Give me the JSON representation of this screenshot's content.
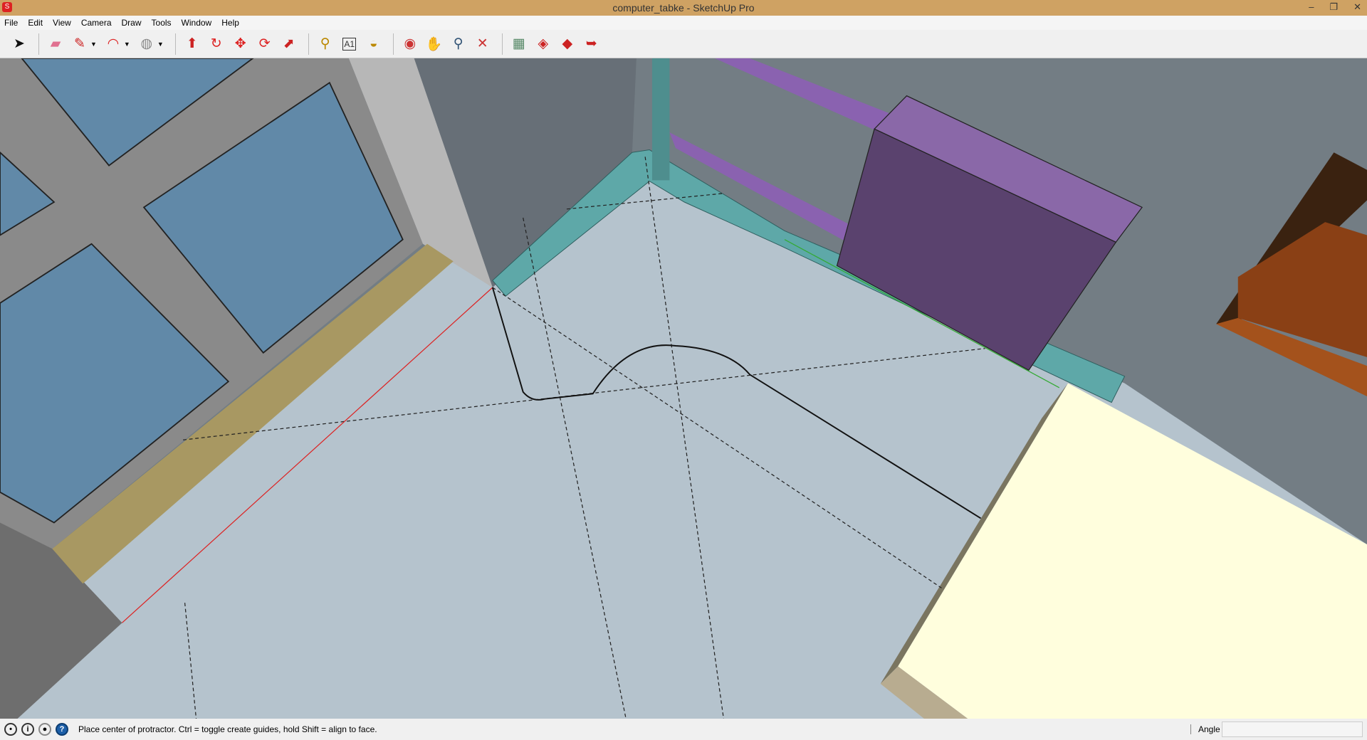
{
  "window": {
    "title": "computer_tabke - SketchUp Pro",
    "minimize": "–",
    "restore": "❐",
    "close": "✕"
  },
  "menu": [
    "File",
    "Edit",
    "View",
    "Camera",
    "Draw",
    "Tools",
    "Window",
    "Help"
  ],
  "toolbar": [
    {
      "name": "select-tool",
      "glyph": "➤",
      "color": "#111"
    },
    {
      "name": "eraser-tool",
      "glyph": "▰",
      "color": "#e07090"
    },
    {
      "name": "pencil-tool",
      "glyph": "✎",
      "color": "#c22",
      "dropdown": true
    },
    {
      "name": "arc-tool",
      "glyph": "◠",
      "color": "#d22",
      "dropdown": true
    },
    {
      "name": "circle-tool",
      "glyph": "◍",
      "color": "#888",
      "dropdown": true
    },
    {
      "name": "push-pull-tool",
      "glyph": "⬆",
      "color": "#c22"
    },
    {
      "name": "follow-me-tool",
      "glyph": "↻",
      "color": "#d22"
    },
    {
      "name": "move-tool",
      "glyph": "✥",
      "color": "#d22"
    },
    {
      "name": "rotate-tool",
      "glyph": "⟳",
      "color": "#d22"
    },
    {
      "name": "scale-tool",
      "glyph": "⬈",
      "color": "#c22"
    },
    {
      "name": "tape-measure-tool",
      "glyph": "⚲",
      "color": "#b80"
    },
    {
      "name": "text-tool",
      "glyph": "A1",
      "color": "#333"
    },
    {
      "name": "paint-bucket-tool",
      "glyph": "◒",
      "color": "#b80"
    },
    {
      "name": "orbit-tool",
      "glyph": "◉",
      "color": "#c33"
    },
    {
      "name": "pan-tool",
      "glyph": "✋",
      "color": "#555"
    },
    {
      "name": "zoom-tool",
      "glyph": "⚲",
      "color": "#357"
    },
    {
      "name": "zoom-extents-tool",
      "glyph": "✕",
      "color": "#c33"
    },
    {
      "name": "3d-warehouse-button",
      "glyph": "▦",
      "color": "#586"
    },
    {
      "name": "extension-warehouse-button",
      "glyph": "◈",
      "color": "#c22"
    },
    {
      "name": "share-component-button",
      "glyph": "◆",
      "color": "#c22"
    },
    {
      "name": "share-model-button",
      "glyph": "➥",
      "color": "#c22"
    }
  ],
  "status": {
    "message": "Place center of protractor. Ctrl = toggle create guides, hold Shift = align to face.",
    "measurement_label": "Angle",
    "measurement_value": ""
  }
}
